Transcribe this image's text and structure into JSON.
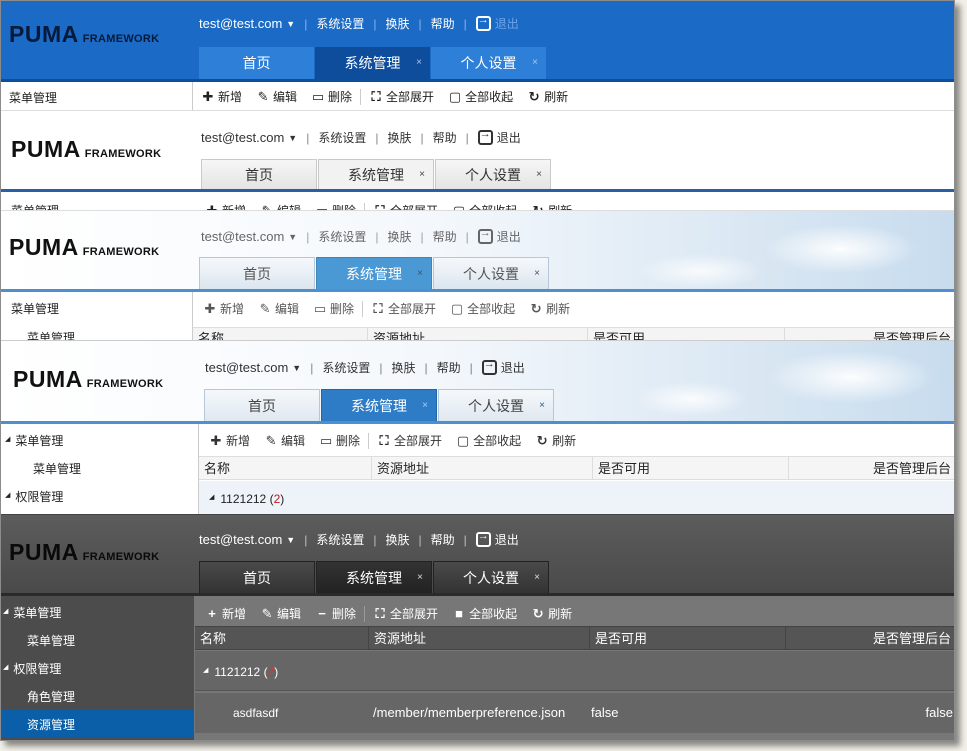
{
  "logo": {
    "big": "PUMA",
    "small": "FRAMEWORK"
  },
  "topnav": {
    "user": "test@test.com",
    "caret": "▼",
    "items": [
      "系统设置",
      "换肤",
      "帮助"
    ],
    "separator": "|",
    "logout": "退出"
  },
  "tabs": [
    {
      "label": "首页",
      "closable": false
    },
    {
      "label": "系统管理",
      "closable": true
    },
    {
      "label": "个人设置",
      "closable": true
    }
  ],
  "close_glyph": "×",
  "toolbar": {
    "add": "新增",
    "edit": "编辑",
    "delete": "删除",
    "expand_all": "全部展开",
    "collapse_all": "全部收起",
    "refresh": "刷新"
  },
  "sidebar": {
    "menu_mgmt": "菜单管理",
    "menu_mgmt_child": "菜单管理",
    "permission_mgmt": "权限管理",
    "role_mgmt": "角色管理",
    "resource_mgmt": "资源管理"
  },
  "grid": {
    "columns": [
      "名称",
      "资源地址",
      "是否可用",
      "是否管理后台"
    ],
    "group": {
      "label": "1121212",
      "count_open": "(",
      "count": "2",
      "count_close": ")"
    },
    "row": {
      "name": "asdfasdf",
      "url": "/member/memberpreference.json",
      "enabled": "false",
      "admin": "false"
    }
  },
  "themes": {
    "blue": {
      "header": "#1a6ac6",
      "active_tab": "#0e4c9c"
    },
    "light": {
      "header": "#ffffff",
      "rule": "#2b5fa5"
    },
    "sky": {
      "header": "#c7dcee",
      "active_tab": "#4a98d4"
    },
    "sky_blue": {
      "header": "#c7dcee",
      "active_tab": "#2e7bc6"
    },
    "dark": {
      "header": "#4a4a4a",
      "selected_row": "#0a5fa8"
    }
  }
}
